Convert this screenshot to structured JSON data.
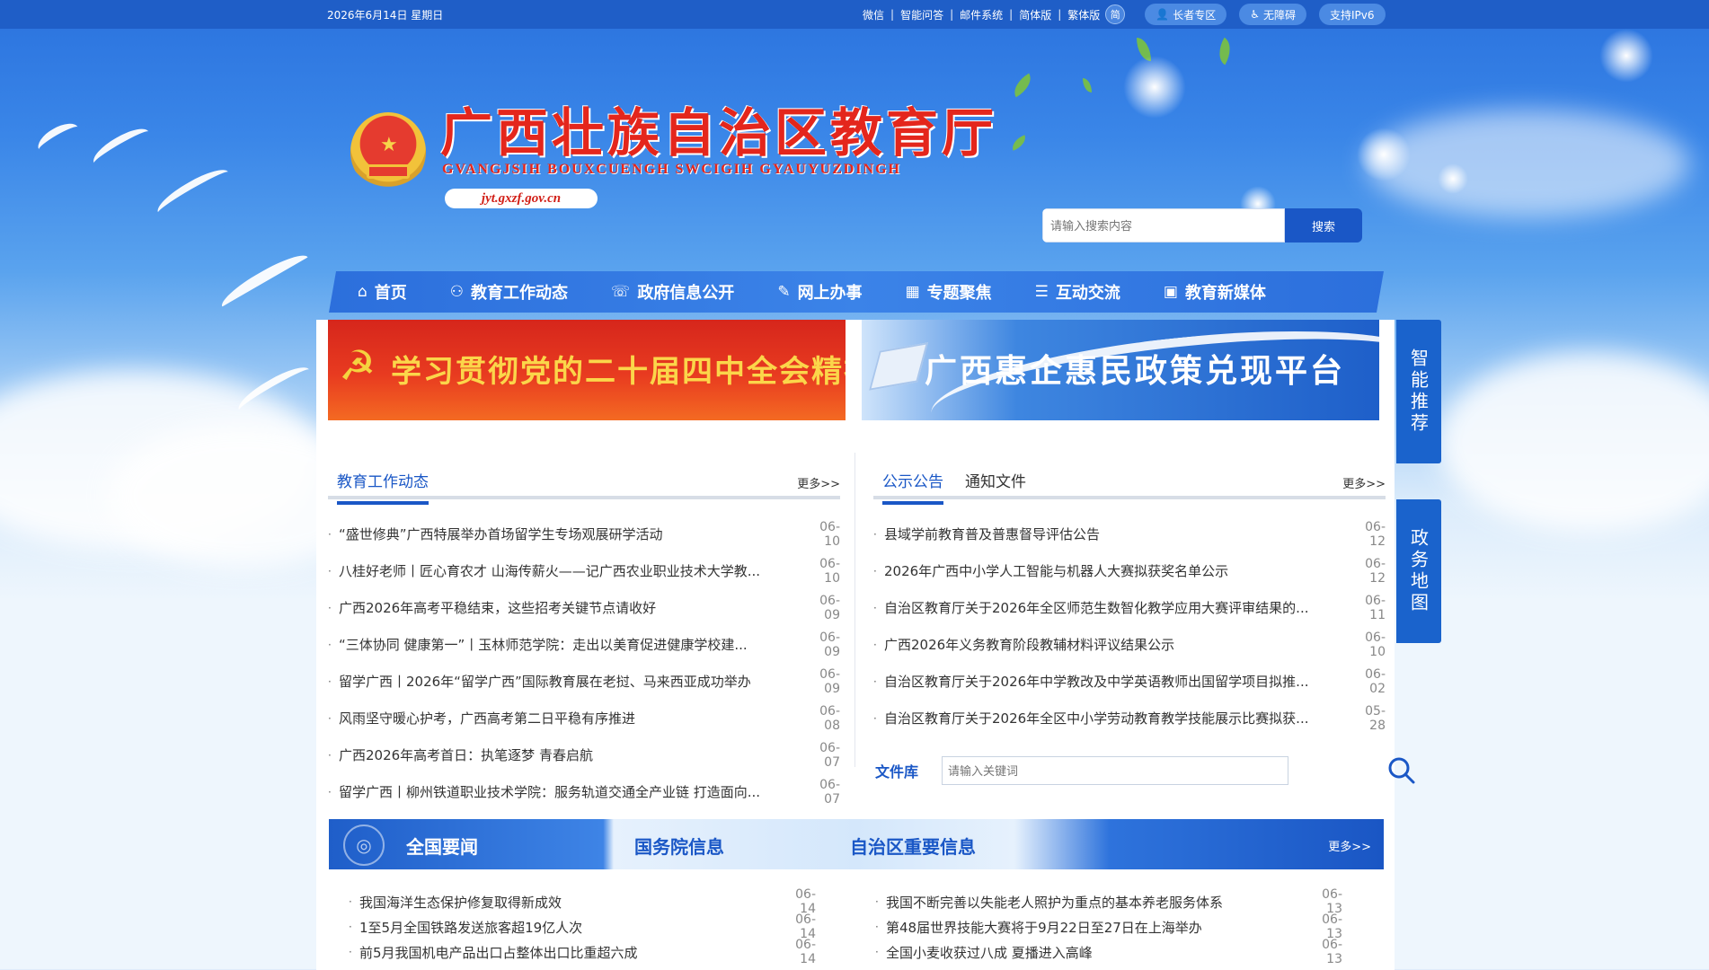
{
  "topbar": {
    "date": "2026年6月14日  星期日",
    "links": [
      "微信",
      "智能问答",
      "邮件系统",
      "简体版",
      "繁体版"
    ],
    "circle_label": "简",
    "pills": [
      "长者专区",
      "无障碍",
      "支持IPv6"
    ]
  },
  "header": {
    "title": "广西壮族自治区教育厅",
    "title_en": "GVANGJSIH BOUXCUENGH SWCIGIH GYAUYUZDINGH",
    "url": "jyt.gxzf.gov.cn"
  },
  "search": {
    "placeholder": "请输入搜索内容",
    "button": "搜索"
  },
  "nav": [
    {
      "label": "首页",
      "icon": "home-icon"
    },
    {
      "label": "教育工作动态",
      "icon": "org-chart-icon"
    },
    {
      "label": "政府信息公开",
      "icon": "chat-bubble-icon"
    },
    {
      "label": "网上办事",
      "icon": "document-edit-icon"
    },
    {
      "label": "专题聚焦",
      "icon": "grid-icon"
    },
    {
      "label": "互动交流",
      "icon": "server-icon"
    },
    {
      "label": "教育新媒体",
      "icon": "media-icon"
    }
  ],
  "banners": [
    {
      "text": "学习贯彻党的二十届四中全会精神",
      "color": "#e0301e"
    },
    {
      "text": "广西惠企惠民政策兑现平台",
      "color": "#1e5fc9"
    }
  ],
  "left_section": {
    "tab": "教育工作动态",
    "more": "更多>>",
    "items": [
      {
        "title": "“盛世修典”广西特展举办首场留学生专场观展研学活动",
        "date": "06-10"
      },
      {
        "title": "八桂好老师丨匠心育农才 山海传薪火——记广西农业职业技术大学教...",
        "date": "06-10"
      },
      {
        "title": "广西2026年高考平稳结束，这些招考关键节点请收好",
        "date": "06-09"
      },
      {
        "title": "“三体协同 健康第一”丨玉林师范学院：走出以美育促进健康学校建...",
        "date": "06-09"
      },
      {
        "title": "留学广西丨2026年“留学广西”国际教育展在老挝、马来西亚成功举办",
        "date": "06-09"
      },
      {
        "title": "风雨坚守暖心护考，广西高考第二日平稳有序推进",
        "date": "06-08"
      },
      {
        "title": "广西2026年高考首日：执笔逐梦 青春启航",
        "date": "06-07"
      },
      {
        "title": "留学广西丨柳州铁道职业技术学院：服务轨道交通全产业链 打造面向...",
        "date": "06-07"
      }
    ]
  },
  "right_section": {
    "tabs": [
      "公示公告",
      "通知文件"
    ],
    "more": "更多>>",
    "items": [
      {
        "title": "县域学前教育普及普惠督导评估公告",
        "date": "06-12"
      },
      {
        "title": "2026年广西中小学人工智能与机器人大赛拟获奖名单公示",
        "date": "06-12"
      },
      {
        "title": "自治区教育厅关于2026年全区师范生数智化教学应用大赛评审结果的...",
        "date": "06-11"
      },
      {
        "title": "广西2026年义务教育阶段教辅材料评议结果公示",
        "date": "06-10"
      },
      {
        "title": "自治区教育厅关于2026年中学教改及中学英语教师出国留学项目拟推...",
        "date": "06-02"
      },
      {
        "title": "自治区教育厅关于2026年全区中小学劳动教育教学技能展示比赛拟获...",
        "date": "05-28"
      }
    ],
    "file_library": {
      "label": "文件库",
      "placeholder": "请输入关键词"
    }
  },
  "news_bar": {
    "tabs": [
      "全国要闻",
      "国务院信息",
      "自治区重要信息"
    ],
    "more": "更多>>",
    "left_items": [
      {
        "title": "我国海洋生态保护修复取得新成效",
        "date": "06-14"
      },
      {
        "title": "1至5月全国铁路发送旅客超19亿人次",
        "date": "06-14"
      },
      {
        "title": "前5月我国机电产品出口占整体出口比重超六成",
        "date": "06-14"
      }
    ],
    "right_items": [
      {
        "title": "我国不断完善以失能老人照护为重点的基本养老服务体系",
        "date": "06-13"
      },
      {
        "title": "第48届世界技能大赛将于9月22日至27日在上海举办",
        "date": "06-13"
      },
      {
        "title": "全国小麦收获过八成 夏播进入高峰",
        "date": "06-13"
      }
    ]
  },
  "side_tabs": [
    "智能推荐",
    "政务地图"
  ],
  "colors": {
    "primary": "#1a57c6",
    "brand_red": "#e4261c",
    "topbar": "#1f5ec7"
  }
}
